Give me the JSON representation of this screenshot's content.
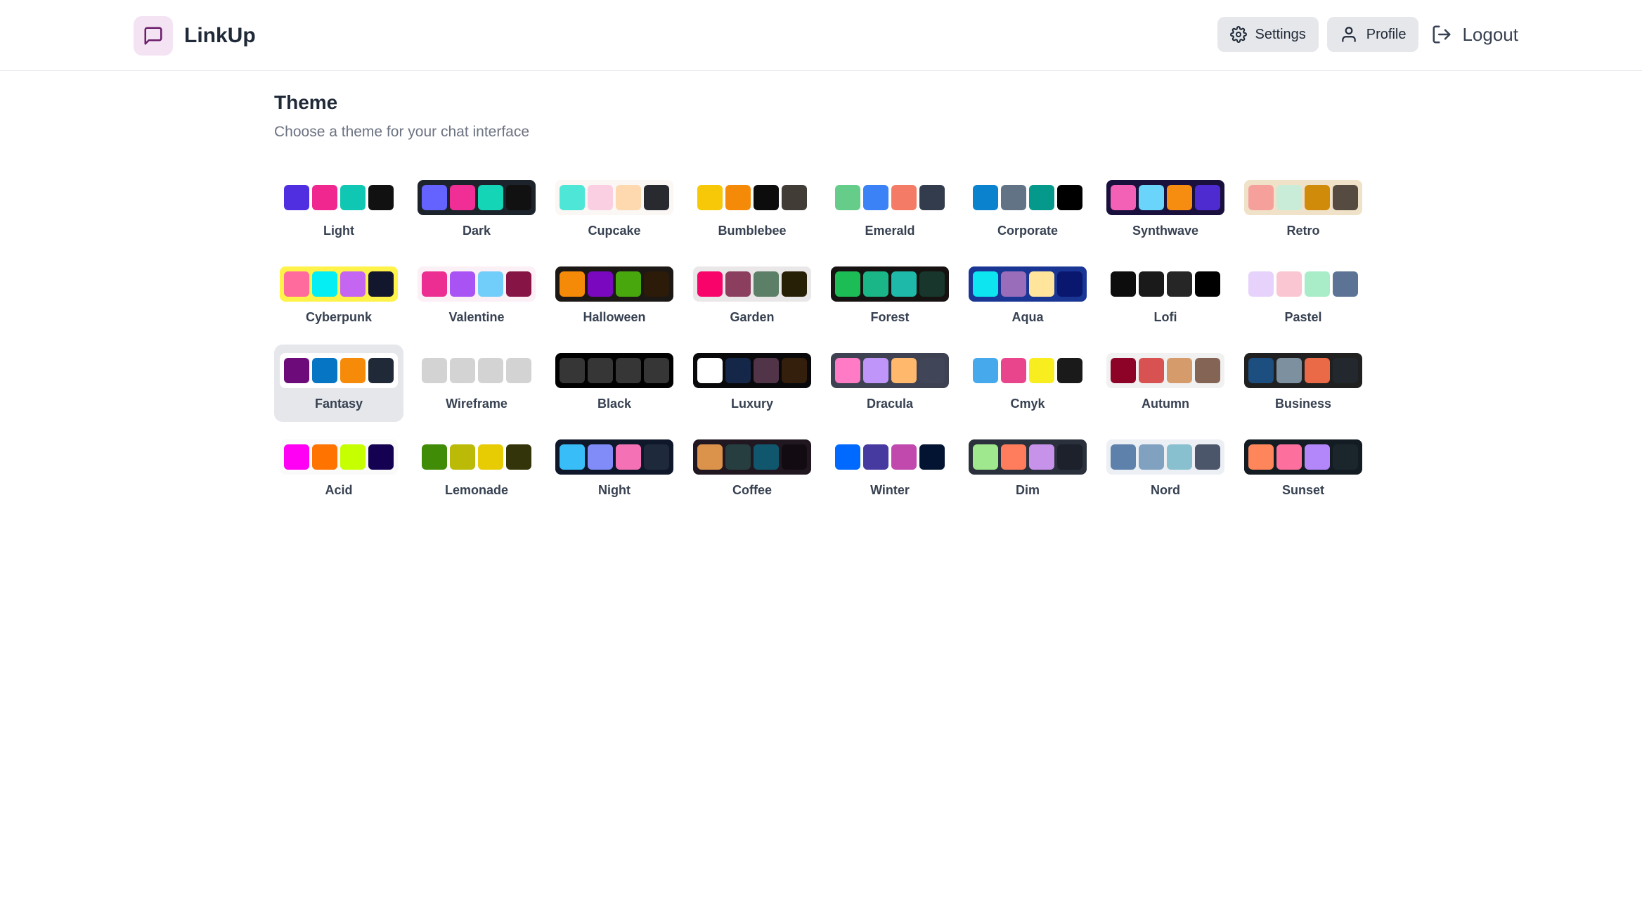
{
  "app": {
    "name": "LinkUp"
  },
  "nav": {
    "settings": "Settings",
    "profile": "Profile",
    "logout": "Logout"
  },
  "page": {
    "title": "Theme",
    "subtitle": "Choose a theme for your chat interface"
  },
  "themes": [
    {
      "name": "Light",
      "bg": "#ffffff",
      "colors": [
        "#4f2fe0",
        "#f0278f",
        "#10c7b4",
        "#111111"
      ]
    },
    {
      "name": "Dark",
      "bg": "#1d232a",
      "colors": [
        "#6563ff",
        "#f02e96",
        "#14d6b7",
        "#111111"
      ]
    },
    {
      "name": "Cupcake",
      "bg": "#faf7f5",
      "colors": [
        "#4ee6d6",
        "#f9cfe1",
        "#fed9b0",
        "#282a2f"
      ]
    },
    {
      "name": "Bumblebee",
      "bg": "#ffffff",
      "colors": [
        "#f7c807",
        "#f58a09",
        "#0c0c0c",
        "#423c37"
      ]
    },
    {
      "name": "Emerald",
      "bg": "#ffffff",
      "colors": [
        "#66cc8a",
        "#3b82f6",
        "#f47c66",
        "#333c4d"
      ]
    },
    {
      "name": "Corporate",
      "bg": "#ffffff",
      "colors": [
        "#0a82ce",
        "#627386",
        "#05998b",
        "#000000"
      ]
    },
    {
      "name": "Synthwave",
      "bg": "#1a103d",
      "colors": [
        "#f361b7",
        "#6bd4fa",
        "#f68c10",
        "#4e2bd0"
      ]
    },
    {
      "name": "Retro",
      "bg": "#f0e2c8",
      "colors": [
        "#f6a09c",
        "#c8ecd8",
        "#d18b0b",
        "#554b40"
      ]
    },
    {
      "name": "Cyberpunk",
      "bg": "#fff249",
      "colors": [
        "#ff6b9c",
        "#05eef4",
        "#c466f2",
        "#12172e"
      ]
    },
    {
      "name": "Valentine",
      "bg": "#fbf0f5",
      "colors": [
        "#ec2e93",
        "#a953f5",
        "#71cdf9",
        "#861444"
      ]
    },
    {
      "name": "Halloween",
      "bg": "#1b1816",
      "colors": [
        "#f58a09",
        "#7a08bf",
        "#48a70d",
        "#2d1b0a"
      ]
    },
    {
      "name": "Garden",
      "bg": "#e9e7e7",
      "colors": [
        "#f8036a",
        "#8c3e5e",
        "#5c7f67",
        "#281f07"
      ]
    },
    {
      "name": "Forest",
      "bg": "#171212",
      "colors": [
        "#1dbd56",
        "#1bb687",
        "#1eb9a9",
        "#18362b"
      ]
    },
    {
      "name": "Aqua",
      "bg": "#1a3694",
      "colors": [
        "#0de6f0",
        "#9a6dba",
        "#ffe49c",
        "#0a176f"
      ]
    },
    {
      "name": "Lofi",
      "bg": "#ffffff",
      "colors": [
        "#0d0d0d",
        "#1a1a1a",
        "#262626",
        "#000000"
      ]
    },
    {
      "name": "Pastel",
      "bg": "#ffffff",
      "colors": [
        "#e6d2fb",
        "#fac6d2",
        "#a8ecc8",
        "#5d7395"
      ]
    },
    {
      "name": "Fantasy",
      "bg": "#ffffff",
      "colors": [
        "#6e0b7b",
        "#0575c4",
        "#f68a09",
        "#1f2937"
      ]
    },
    {
      "name": "Wireframe",
      "bg": "#ffffff",
      "colors": [
        "#d3d3d3",
        "#d3d3d3",
        "#d3d3d3",
        "#d3d3d3"
      ]
    },
    {
      "name": "Black",
      "bg": "#000000",
      "colors": [
        "#363636",
        "#363636",
        "#363636",
        "#363636"
      ]
    },
    {
      "name": "Luxury",
      "bg": "#09090b",
      "colors": [
        "#ffffff",
        "#152748",
        "#513448",
        "#331f0b"
      ]
    },
    {
      "name": "Dracula",
      "bg": "#3d4152",
      "colors": [
        "#ff7bc5",
        "#bf95fa",
        "#ffb86c",
        "#414558"
      ]
    },
    {
      "name": "Cmyk",
      "bg": "#ffffff",
      "colors": [
        "#46a9eb",
        "#e9458d",
        "#f8ed1f",
        "#1a1a1a"
      ]
    },
    {
      "name": "Autumn",
      "bg": "#f1f1f1",
      "colors": [
        "#8c0327",
        "#d85251",
        "#d59b6a",
        "#836455"
      ]
    },
    {
      "name": "Business",
      "bg": "#202020",
      "colors": [
        "#1c4e80",
        "#7c909f",
        "#ea6947",
        "#23282e"
      ]
    },
    {
      "name": "Acid",
      "bg": "#fafafa",
      "colors": [
        "#ff00f4",
        "#ff7400",
        "#c6ff00",
        "#140151"
      ]
    },
    {
      "name": "Lemonade",
      "bg": "#ffffff",
      "colors": [
        "#418c06",
        "#bbbb07",
        "#e8cc03",
        "#333409"
      ]
    },
    {
      "name": "Night",
      "bg": "#0f172a",
      "colors": [
        "#38bdf8",
        "#818cf8",
        "#f471b5",
        "#1e293b"
      ]
    },
    {
      "name": "Coffee",
      "bg": "#211720",
      "colors": [
        "#db924b",
        "#263e3f",
        "#10576d",
        "#120c12"
      ]
    },
    {
      "name": "Winter",
      "bg": "#ffffff",
      "colors": [
        "#0069ff",
        "#463aa1",
        "#c148ac",
        "#021431"
      ]
    },
    {
      "name": "Dim",
      "bg": "#2a303c",
      "colors": [
        "#9fe88d",
        "#ff7d5c",
        "#c792e9",
        "#1c212b"
      ]
    },
    {
      "name": "Nord",
      "bg": "#eceff4",
      "colors": [
        "#5e81ac",
        "#81a1c1",
        "#88c0d0",
        "#4c566a"
      ]
    },
    {
      "name": "Sunset",
      "bg": "#121c22",
      "colors": [
        "#ff865b",
        "#fd6f9c",
        "#b387fa",
        "#1b262c"
      ]
    }
  ],
  "selected_theme": "Fantasy"
}
